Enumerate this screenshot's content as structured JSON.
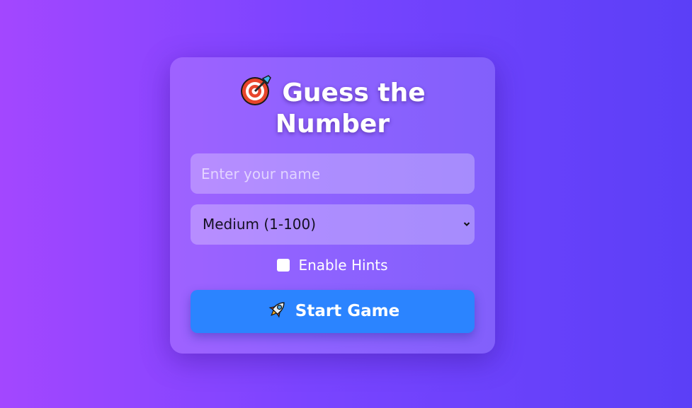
{
  "card": {
    "title_line1": "Guess the",
    "title_line2": "Number",
    "title_icon": "target-icon",
    "name_input": {
      "placeholder": "Enter your name",
      "value": ""
    },
    "difficulty_select": {
      "selected": "Medium (1-100)"
    },
    "hints_checkbox": {
      "label": "Enable Hints",
      "checked": false
    },
    "start_button": {
      "label": "Start Game",
      "icon": "rocket-icon"
    }
  },
  "colors": {
    "background_start": "#a347ff",
    "background_end": "#5b3ff7",
    "button": "#2b84ff",
    "text": "#ffffff"
  }
}
